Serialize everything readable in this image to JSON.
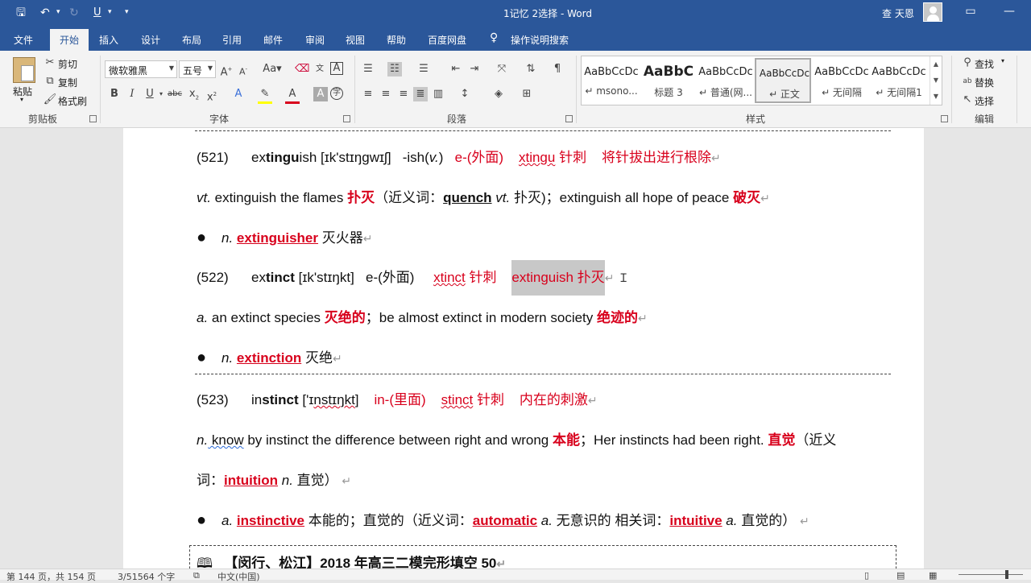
{
  "titlebar": {
    "doc_title": "1记忆 2选择 - Word",
    "user_name": "查 天恩",
    "save_icon": "save-icon",
    "undo_icon": "undo-icon",
    "redo_icon": "redo-icon",
    "underline_btn": "U",
    "customize_icon": "customize-icon"
  },
  "tabs": [
    "文件",
    "开始",
    "插入",
    "设计",
    "布局",
    "引用",
    "邮件",
    "审阅",
    "视图",
    "帮助",
    "百度网盘"
  ],
  "tell_me": "操作说明搜索",
  "ribbon": {
    "clipboard": {
      "paste": "粘贴",
      "cut": "剪切",
      "copy": "复制",
      "format_painter": "格式刷",
      "label": "剪贴板"
    },
    "font": {
      "name": "微软雅黑",
      "size": "五号",
      "label": "字体"
    },
    "paragraph": {
      "label": "段落"
    },
    "styles": {
      "label": "样式",
      "items": [
        {
          "sample": "AaBbCcDc",
          "name": "↵ msono..."
        },
        {
          "sample": "AaBbC",
          "name": "标题 3"
        },
        {
          "sample": "AaBbCcDc",
          "name": "↵ 普通(网..."
        },
        {
          "sample": "AaBbCcDc",
          "name": "↵ 正文"
        },
        {
          "sample": "AaBbCcDc",
          "name": "↵ 无间隔"
        },
        {
          "sample": "AaBbCcDc",
          "name": "↵ 无间隔1"
        }
      ]
    },
    "editing": {
      "find": "查找",
      "replace": "替换",
      "select": "选择",
      "label": "编辑"
    }
  },
  "doc": {
    "e521": {
      "num": "(521)",
      "w1": "ex",
      "w2": "tingu",
      "w3": "ish",
      "ipa": "[ɪk'stɪŋgwɪʃ]",
      "suffix": "-ish(",
      "suffix_v": "v.",
      "suffix_end": ")",
      "prefix": "e-(外面)",
      "root": "xtingu",
      "root_cn": " 针刺",
      "meaning": "将针拔出进行根除"
    },
    "e521_l2": {
      "pos": "vt.",
      "t1": " extinguish the flames ",
      "cn1": "扑灭",
      "t2": "（近义词：",
      "syn": "quench",
      "pos2": " vt.",
      "t3": " 扑灭)；extinguish all hope of peace ",
      "cn2": "破灭"
    },
    "e521_l3": {
      "pos": "n.",
      "word": "extinguisher",
      "cn": " 灭火器"
    },
    "e522": {
      "num": "(522)",
      "w1": "ex",
      "w2": "tinct",
      "ipa": "[ɪk'stɪŋkt]",
      "prefix": "e-(外面)",
      "root": "xtinct",
      "root_cn": " 针刺",
      "sel": "extinguish  扑灭"
    },
    "e522_l2": {
      "pos": "a.",
      "t1": " an extinct species ",
      "cn1": "灭绝的",
      "t2": "；be almost extinct in modern society ",
      "cn2": "绝迹的"
    },
    "e522_l3": {
      "pos": "n.",
      "word": "extinction",
      "cn": " 灭绝"
    },
    "e523": {
      "num": "(523)",
      "w1": "in",
      "w2": "stinct",
      "ipa_a": "['ɪ",
      "ipa_b": "nstɪ",
      "ipa_c": "ŋkt",
      "ipa_d": "]",
      "prefix": "in-(里面)",
      "root": "stinct",
      "root_cn": " 针刺",
      "meaning": "内在的刺激"
    },
    "e523_l2": {
      "pos": "n.",
      "w": " know",
      "t1": " by instinct the difference between right and wrong ",
      "cn1": "本能",
      "t2": "；Her instincts had been right. ",
      "cn2": "直觉",
      "t3": "（近义"
    },
    "e523_l3": {
      "t1": "词：",
      "word": "intuition",
      "pos": " n.",
      "t2": " 直觉）"
    },
    "e523_l4": {
      "pos": "a.",
      "word": "instinctive",
      "t1": " 本能的；直觉的（近义词：",
      "syn": "automatic",
      "pos2": " a.",
      "t2": " 无意识的  相关词：",
      "rel": "intuitive",
      "pos3": " a.",
      "t3": " 直觉的）"
    },
    "box": {
      "icon": "book-icon",
      "text": "【闵行、松江】2018 年高三二模完形填空 50"
    },
    "para_mark": "↵"
  },
  "status": {
    "page": "第 144 页，共 154 页",
    "words": "3/51564 个字",
    "lang": "中文(中国)"
  }
}
